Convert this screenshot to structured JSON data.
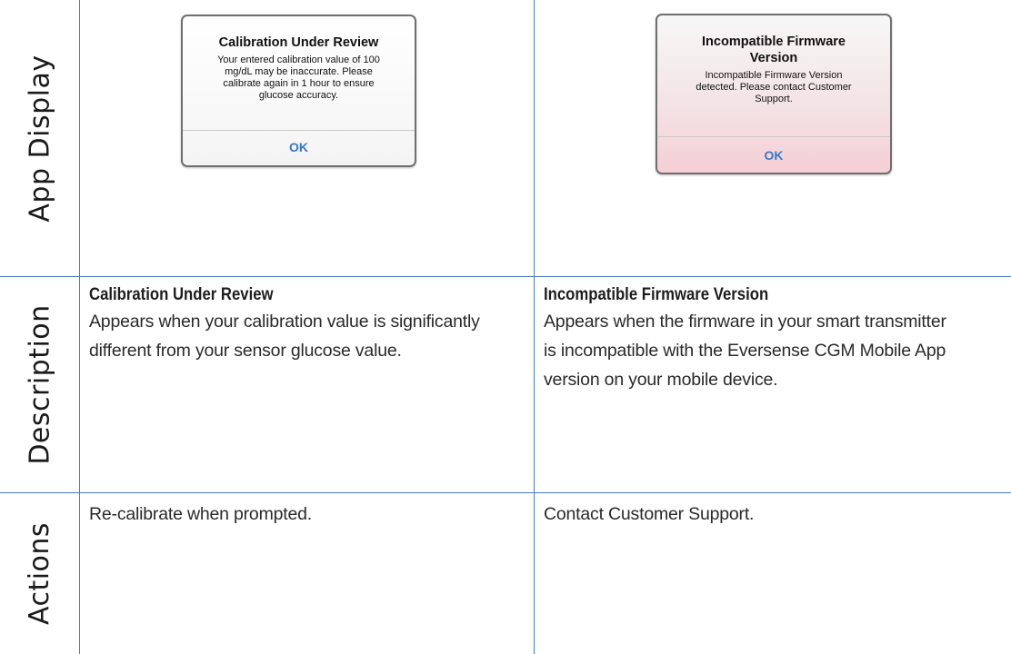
{
  "row_labels": {
    "app_display": "App Display",
    "description": "Description",
    "actions": "Actions"
  },
  "columns": [
    {
      "dialog": {
        "title": "Calibration Under Review",
        "message_lines": [
          "Your entered calibration value of 100",
          "mg/dL may be inaccurate. Please",
          "calibrate again in 1 hour to ensure",
          "glucose accuracy."
        ],
        "button": "OK"
      },
      "description": {
        "title": "Calibration Under Review",
        "lines": [
          "Appears when your calibration value is significantly",
          "different from your sensor glucose value."
        ]
      },
      "action": "Re-calibrate when prompted."
    },
    {
      "dialog": {
        "title_lines": [
          "Incompatible Firmware",
          "Version"
        ],
        "message_lines": [
          "Incompatible Firmware Version",
          "detected. Please contact Customer",
          "Support."
        ],
        "button": "OK"
      },
      "description": {
        "title": "Incompatible Firmware Version",
        "lines": [
          "Appears when the firmware in your smart transmitter",
          "is incompatible with the Eversense CGM Mobile App",
          "version on your mobile device."
        ]
      },
      "action": "Contact Customer Support."
    }
  ],
  "colors": {
    "rule": "#4a7bb7",
    "ok_button": "#3b78c4",
    "warning_dialog_tint": "#f5cfd5"
  }
}
